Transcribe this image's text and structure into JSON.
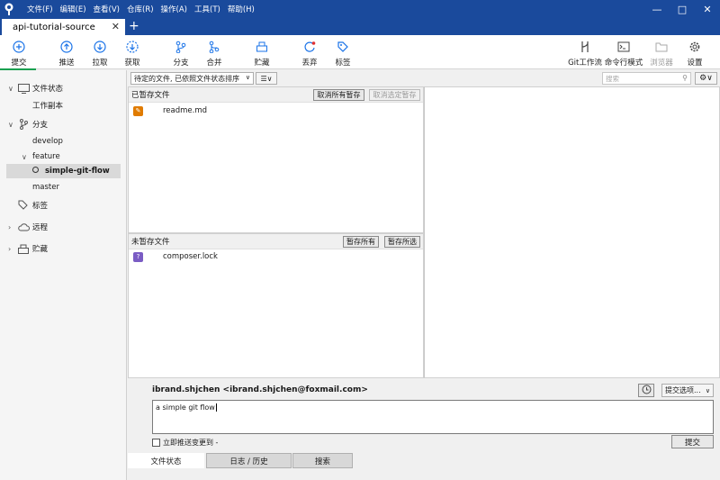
{
  "app": {
    "menu": [
      "文件(F)",
      "编辑(E)",
      "查看(V)",
      "仓库(R)",
      "操作(A)",
      "工具(T)",
      "帮助(H)"
    ],
    "tab_title": "api-tutorial-source"
  },
  "toolbar": {
    "commit": "提交",
    "push": "推送",
    "pull": "拉取",
    "fetch": "获取",
    "branch": "分支",
    "merge": "合并",
    "stash": "贮藏",
    "discard": "丢弃",
    "tag": "标签",
    "git_flow": "Git工作流",
    "terminal": "命令行模式",
    "explorer": "浏览器",
    "settings": "设置"
  },
  "sidebar": {
    "file_status": "文件状态",
    "working_copy": "工作副本",
    "branches": "分支",
    "develop": "develop",
    "feature": "feature",
    "current_branch": "simple-git-flow",
    "master": "master",
    "tags": "标签",
    "remotes": "远程",
    "stashes": "贮藏"
  },
  "filter": {
    "sort_label": "待定的文件, 已依照文件状态排序",
    "search_placeholder": "搜索"
  },
  "staged": {
    "header": "已暂存文件",
    "unstage_all": "取消所有暂存",
    "unstage_selected": "取消选定暂存",
    "files": [
      "readme.md"
    ]
  },
  "unstaged": {
    "header": "未暂存文件",
    "stage_all": "暂存所有",
    "stage_selected": "暂存所选",
    "files": [
      "composer.lock"
    ]
  },
  "commit": {
    "author": "ibrand.shjchen <ibrand.shjchen@foxmail.com>",
    "options": "提交选项...",
    "message": "a simple git flow",
    "push_immediately": "立即推送变更到 -",
    "submit": "提交"
  },
  "bottom_tabs": [
    "文件状态",
    "日志 / 历史",
    "搜索"
  ],
  "colors": {
    "titlebar": "#1a4a9c",
    "accent": "#1a73e8",
    "modified": "#e07b00",
    "untracked": "#7a5cc4"
  }
}
